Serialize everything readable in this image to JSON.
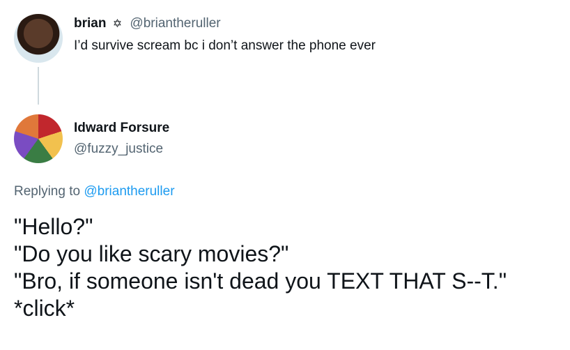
{
  "tweet1": {
    "name": "brian",
    "badge": "✡",
    "handle": "@briantheruller",
    "text": "I’d survive scream bc i don’t answer the phone ever"
  },
  "tweet2": {
    "name": "Idward Forsure",
    "handle": "@fuzzy_justice",
    "replying_prefix": "Replying to",
    "replying_to": "@briantheruller",
    "lines": [
      "\"Hello?\"",
      "\"Do you like scary movies?\"",
      "\"Bro, if someone isn't dead you TEXT THAT S--T.\"",
      "*click*"
    ]
  }
}
